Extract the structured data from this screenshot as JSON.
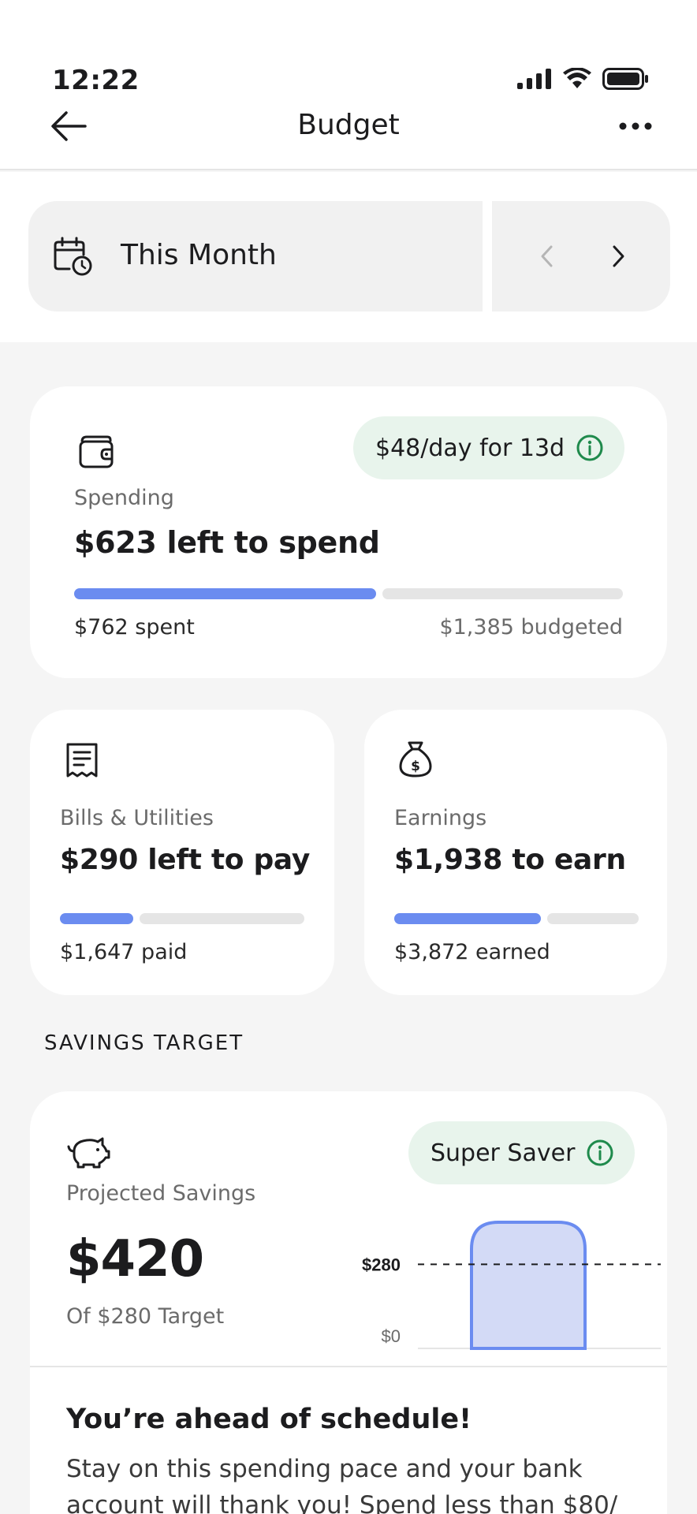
{
  "status_bar": {
    "time": "12:22"
  },
  "header": {
    "title": "Budget"
  },
  "period": {
    "label": "This Month"
  },
  "spending": {
    "badge": "$48/day for 13d",
    "label": "Spending",
    "headline": "$623 left to spend",
    "spent": "$762 spent",
    "budgeted": "$1,385 budgeted",
    "progress": 0.55
  },
  "bills": {
    "label": "Bills & Utilities",
    "headline": "$290 left to pay",
    "paid": "$1,647 paid",
    "progress": 0.3
  },
  "earnings": {
    "label": "Earnings",
    "headline": "$1,938 to earn",
    "earned": "$3,872 earned",
    "progress": 0.6
  },
  "savings_section": {
    "title": "SAVINGS TARGET"
  },
  "savings": {
    "badge": "Super Saver",
    "label": "Projected Savings",
    "amount": "$420",
    "target_text": "Of $280 Target",
    "chart_target_label": "$280",
    "chart_zero_label": "$0",
    "ahead_title": "You’re ahead of schedule!",
    "ahead_body": "Stay on this spending pace and your bank account will thank you! Spend less than $80/"
  },
  "chart_data": {
    "type": "bar",
    "categories": [
      ""
    ],
    "values": [
      420
    ],
    "target": 280,
    "ylim": [
      0,
      420
    ],
    "tick_labels": [
      "$0",
      "$280"
    ]
  },
  "colors": {
    "accent": "#6b8cf0",
    "bar_fill": "#d3daf6",
    "pill_bg": "#e8f4ec",
    "info_green": "#1f8a4c"
  }
}
